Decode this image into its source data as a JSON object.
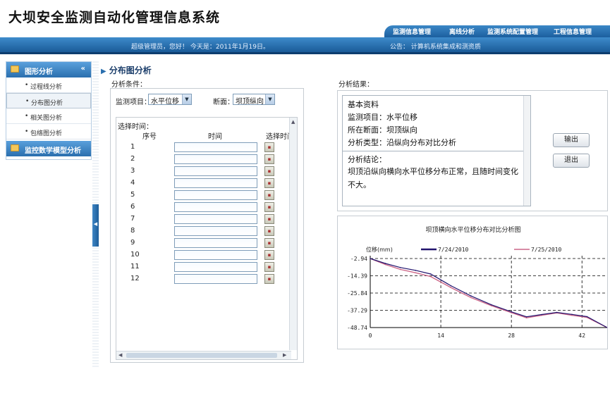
{
  "app": {
    "title": "大坝安全监测自动化管理信息系统"
  },
  "topnav": {
    "items": [
      "监测信息管理",
      "离线分析",
      "监测系统配置管理",
      "工程信息管理"
    ]
  },
  "infobar": {
    "user_text": "超级管理员，您好！ 今天是：2011年1月19日。",
    "notice_text": "公告：    计算机系统集成和测资质"
  },
  "sidebar": {
    "groups": [
      {
        "label": "图形分析",
        "chevron": "«"
      },
      {
        "label": "监控数学模型分析"
      }
    ],
    "items": [
      {
        "label": "过程线分析"
      },
      {
        "label": "分布图分析"
      },
      {
        "label": "相关图分析"
      },
      {
        "label": "包络图分析"
      }
    ]
  },
  "page": {
    "title": "分布图分析",
    "condition_label": "分析条件：",
    "result_label": "分析结果："
  },
  "conditions": {
    "item_label": "监测项目：",
    "item_value": "水平位移",
    "section_label": "断面：",
    "section_value": "坝顶纵向",
    "time_label": "选择时间：",
    "col_seq": "序号",
    "col_time": "时间",
    "col_pick": "选择时间",
    "rows": [
      "1",
      "2",
      "3",
      "4",
      "5",
      "6",
      "7",
      "8",
      "9",
      "10",
      "11",
      "12"
    ]
  },
  "result": {
    "basic_title": "基本资料",
    "item_line": "监测项目：水平位移",
    "section_line": "所在断面：坝顶纵向",
    "type_line": "分析类型：沿纵向分布对比分析",
    "conclusion_title": "分析结论：",
    "conclusion_text": "坝顶沿纵向横向水平位移分布正常，且随时间变化不大。"
  },
  "buttons": {
    "output": "输出",
    "exit": "退出"
  },
  "chart_data": {
    "type": "line",
    "title": "坝顶横向水平位移分布对比分析图",
    "ylabel": "位移(mm)",
    "xlabel": "",
    "yticks": [
      -2.94,
      -14.39,
      -25.84,
      -37.29,
      -48.74
    ],
    "xticks": [
      0,
      14,
      28,
      42
    ],
    "ylim": [
      -48.74,
      -2.94
    ],
    "xlim": [
      0,
      47
    ],
    "grid": true,
    "legend_position": "top",
    "series": [
      {
        "name": "7/24/2010",
        "color": "#22146e",
        "x": [
          0,
          3,
          6,
          9,
          12,
          16,
          20,
          24,
          28,
          31,
          34,
          37,
          40,
          43,
          47
        ],
        "y": [
          -2.94,
          -6.2,
          -8.9,
          -10.8,
          -13.2,
          -21.0,
          -27.8,
          -33.6,
          -38.3,
          -41.6,
          -40.1,
          -38.7,
          -40.0,
          -41.5,
          -48.74
        ]
      },
      {
        "name": "7/25/2010",
        "color": "#cc6688",
        "x": [
          0,
          3,
          6,
          9,
          12,
          16,
          20,
          24,
          28,
          31,
          34,
          37,
          40,
          43,
          47
        ],
        "y": [
          -2.94,
          -6.9,
          -10.2,
          -12.4,
          -14.9,
          -22.2,
          -28.9,
          -34.2,
          -38.9,
          -42.3,
          -40.6,
          -39.0,
          -40.6,
          -42.0,
          -48.74
        ]
      }
    ]
  }
}
